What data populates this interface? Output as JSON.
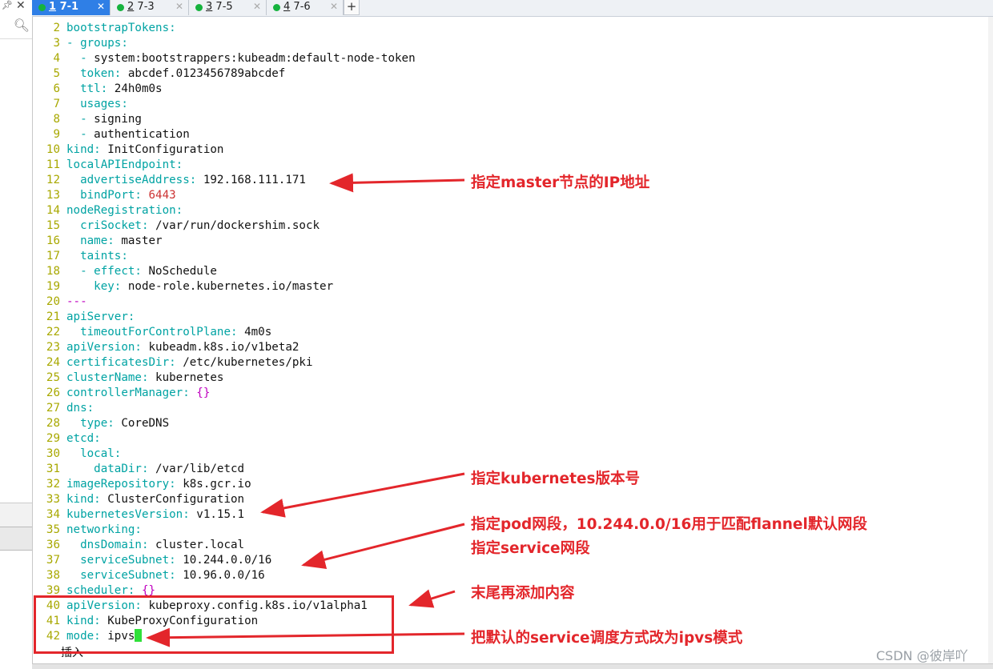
{
  "tabs": [
    {
      "num": "1",
      "title": "7-1",
      "active": true
    },
    {
      "num": "2",
      "title": "7-3",
      "active": false
    },
    {
      "num": "3",
      "title": "7-5",
      "active": false
    },
    {
      "num": "4",
      "title": "7-6",
      "active": false
    }
  ],
  "add_tab_label": "+",
  "editor": {
    "lines": [
      {
        "n": "2",
        "parts": [
          [
            "k",
            "bootstrapTokens:"
          ]
        ]
      },
      {
        "n": "3",
        "parts": [
          [
            "k",
            "- groups:"
          ]
        ]
      },
      {
        "n": "4",
        "parts": [
          [
            "k",
            "  - "
          ],
          [
            "v",
            "system:bootstrappers:kubeadm:default-node-token"
          ]
        ]
      },
      {
        "n": "5",
        "parts": [
          [
            "k",
            "  token: "
          ],
          [
            "v",
            "abcdef.0123456789abcdef"
          ]
        ]
      },
      {
        "n": "6",
        "parts": [
          [
            "k",
            "  ttl: "
          ],
          [
            "v",
            "24h0m0s"
          ]
        ]
      },
      {
        "n": "7",
        "parts": [
          [
            "k",
            "  usages:"
          ]
        ]
      },
      {
        "n": "8",
        "parts": [
          [
            "k",
            "  - "
          ],
          [
            "v",
            "signing"
          ]
        ]
      },
      {
        "n": "9",
        "parts": [
          [
            "k",
            "  - "
          ],
          [
            "v",
            "authentication"
          ]
        ]
      },
      {
        "n": "10",
        "parts": [
          [
            "k",
            "kind: "
          ],
          [
            "v",
            "InitConfiguration"
          ]
        ]
      },
      {
        "n": "11",
        "parts": [
          [
            "k",
            "localAPIEndpoint:"
          ]
        ]
      },
      {
        "n": "12",
        "parts": [
          [
            "k",
            "  advertiseAddress: "
          ],
          [
            "v",
            "192.168.111.171"
          ]
        ]
      },
      {
        "n": "13",
        "parts": [
          [
            "k",
            "  bindPort: "
          ],
          [
            "n",
            "6443"
          ]
        ]
      },
      {
        "n": "14",
        "parts": [
          [
            "k",
            "nodeRegistration:"
          ]
        ]
      },
      {
        "n": "15",
        "parts": [
          [
            "k",
            "  criSocket: "
          ],
          [
            "v",
            "/var/run/dockershim.sock"
          ]
        ]
      },
      {
        "n": "16",
        "parts": [
          [
            "k",
            "  name: "
          ],
          [
            "v",
            "master"
          ]
        ]
      },
      {
        "n": "17",
        "parts": [
          [
            "k",
            "  taints:"
          ]
        ]
      },
      {
        "n": "18",
        "parts": [
          [
            "k",
            "  - effect: "
          ],
          [
            "v",
            "NoSchedule"
          ]
        ]
      },
      {
        "n": "19",
        "parts": [
          [
            "k",
            "    key: "
          ],
          [
            "v",
            "node-role.kubernetes.io/master"
          ]
        ]
      },
      {
        "n": "20",
        "parts": [
          [
            "m",
            "---"
          ]
        ]
      },
      {
        "n": "21",
        "parts": [
          [
            "k",
            "apiServer:"
          ]
        ]
      },
      {
        "n": "22",
        "parts": [
          [
            "k",
            "  timeoutForControlPlane: "
          ],
          [
            "v",
            "4m0s"
          ]
        ]
      },
      {
        "n": "23",
        "parts": [
          [
            "k",
            "apiVersion: "
          ],
          [
            "v",
            "kubeadm.k8s.io/v1beta2"
          ]
        ]
      },
      {
        "n": "24",
        "parts": [
          [
            "k",
            "certificatesDir: "
          ],
          [
            "v",
            "/etc/kubernetes/pki"
          ]
        ]
      },
      {
        "n": "25",
        "parts": [
          [
            "k",
            "clusterName: "
          ],
          [
            "v",
            "kubernetes"
          ]
        ]
      },
      {
        "n": "26",
        "parts": [
          [
            "k",
            "controllerManager: "
          ],
          [
            "m",
            "{}"
          ]
        ]
      },
      {
        "n": "27",
        "parts": [
          [
            "k",
            "dns:"
          ]
        ]
      },
      {
        "n": "28",
        "parts": [
          [
            "k",
            "  type: "
          ],
          [
            "v",
            "CoreDNS"
          ]
        ]
      },
      {
        "n": "29",
        "parts": [
          [
            "k",
            "etcd:"
          ]
        ]
      },
      {
        "n": "30",
        "parts": [
          [
            "k",
            "  local:"
          ]
        ]
      },
      {
        "n": "31",
        "parts": [
          [
            "k",
            "    dataDir: "
          ],
          [
            "v",
            "/var/lib/etcd"
          ]
        ]
      },
      {
        "n": "32",
        "parts": [
          [
            "k",
            "imageRepository: "
          ],
          [
            "v",
            "k8s.gcr.io"
          ]
        ]
      },
      {
        "n": "33",
        "parts": [
          [
            "k",
            "kind: "
          ],
          [
            "v",
            "ClusterConfiguration"
          ]
        ]
      },
      {
        "n": "34",
        "parts": [
          [
            "k",
            "kubernetesVersion: "
          ],
          [
            "v",
            "v1.15.1"
          ]
        ]
      },
      {
        "n": "35",
        "parts": [
          [
            "k",
            "networking:"
          ]
        ]
      },
      {
        "n": "36",
        "parts": [
          [
            "k",
            "  dnsDomain: "
          ],
          [
            "v",
            "cluster.local"
          ]
        ]
      },
      {
        "n": "37",
        "parts": [
          [
            "k",
            "  serviceSubnet: "
          ],
          [
            "v",
            "10.244.0.0/16"
          ]
        ]
      },
      {
        "n": "38",
        "parts": [
          [
            "k",
            "  serviceSubnet: "
          ],
          [
            "v",
            "10.96.0.0/16"
          ]
        ]
      },
      {
        "n": "39",
        "parts": [
          [
            "k",
            "scheduler: "
          ],
          [
            "m",
            "{}"
          ]
        ]
      },
      {
        "n": "40",
        "parts": [
          [
            "k",
            "apiVersion: "
          ],
          [
            "v",
            "kubeproxy.config.k8s.io/v1alpha1"
          ]
        ]
      },
      {
        "n": "41",
        "parts": [
          [
            "k",
            "kind: "
          ],
          [
            "v",
            "KubeProxyConfiguration"
          ]
        ]
      },
      {
        "n": "42",
        "parts": [
          [
            "k",
            "mode: "
          ],
          [
            "v",
            "ipvs"
          ]
        ],
        "cursor": true
      }
    ]
  },
  "status_text": "插入",
  "annotations": {
    "master_ip": "指定master节点的IP地址",
    "k8s_version": "指定kubernetes版本号",
    "pod_subnet": "指定pod网段，10.244.0.0/16用于匹配flannel默认网段",
    "service_subnet": "指定service网段",
    "append_tail": "末尾再添加内容",
    "ipvs_mode": "把默认的service调度方式改为ipvs模式"
  },
  "watermark": "CSDN @彼岸吖",
  "colors": {
    "accent_tab": "#2f7fe6",
    "tab_dot": "#16b33e",
    "yaml_key": "#00a3a3",
    "line_number": "#a8a800",
    "number_literal": "#cc3333",
    "brace_literal": "#c000c0",
    "annotation_red": "#e3262b",
    "cursor": "#2fe039"
  }
}
